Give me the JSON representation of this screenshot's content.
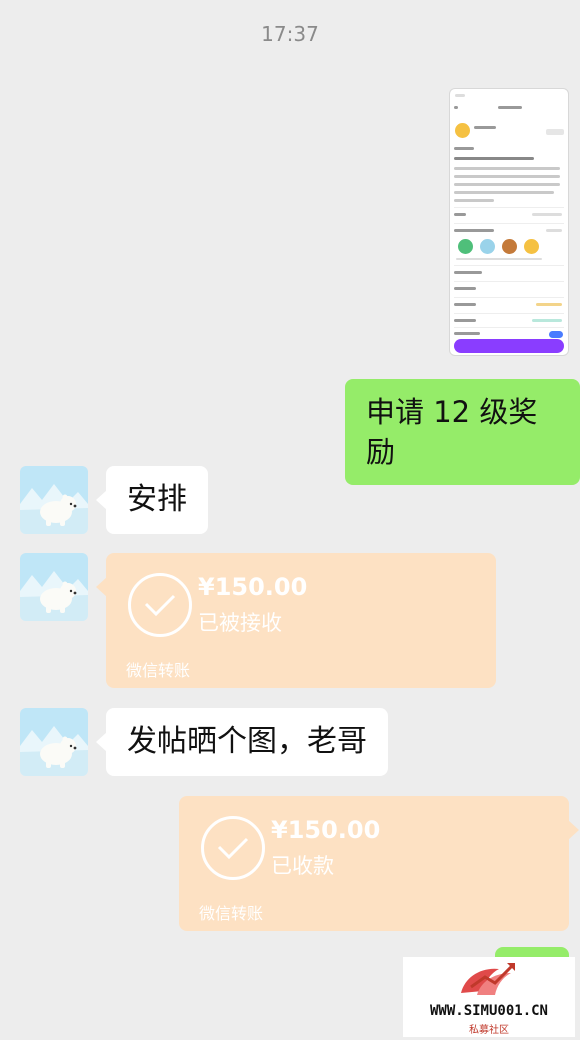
{
  "chat": {
    "timestamp": "17:37",
    "messages": [
      {
        "side": "out",
        "type": "image",
        "content": "screenshot-thumbnail"
      },
      {
        "side": "out",
        "type": "text",
        "content": "申请 12 级奖励"
      },
      {
        "side": "in",
        "type": "text",
        "content": "安排"
      },
      {
        "side": "in",
        "type": "transfer",
        "amount": "¥150.00",
        "status": "已被接收",
        "source": "微信转账"
      },
      {
        "side": "in",
        "type": "text",
        "content": "发帖晒个图，老哥"
      },
      {
        "side": "out",
        "type": "transfer",
        "amount": "¥150.00",
        "status": "已收款",
        "source": "微信转账"
      }
    ]
  },
  "watermark": {
    "url": "WWW.SIMU001.CN",
    "subtitle": "私募社区"
  },
  "colors": {
    "background": "#ededed",
    "outgoing_bubble": "#95ec69",
    "incoming_bubble": "#ffffff",
    "transfer_card": "#fde1c3"
  },
  "icons": {
    "avatar": "polar-bear-avatar",
    "transfer_status": "check-circle-icon"
  }
}
